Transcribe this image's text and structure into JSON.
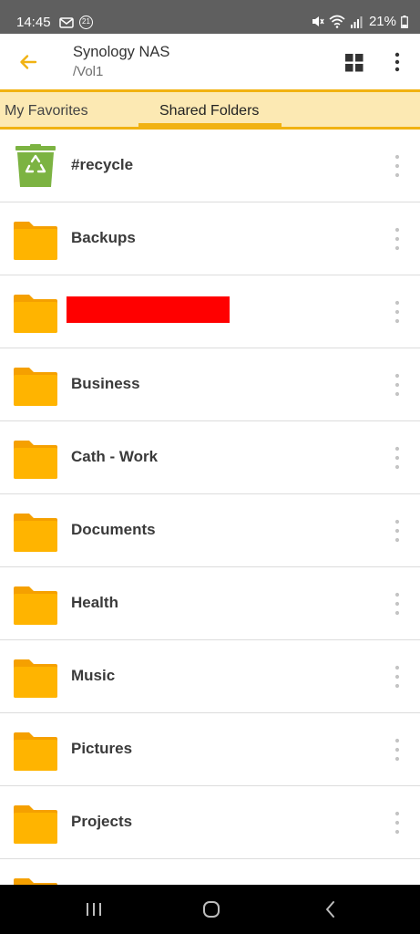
{
  "status_bar": {
    "time": "14:45",
    "notification_badge": "21",
    "battery": "21%"
  },
  "app_bar": {
    "title": "Synology NAS",
    "subtitle": "/Vol1"
  },
  "tabs": [
    {
      "label": "My Favorites",
      "active": false
    },
    {
      "label": "Shared Folders",
      "active": true
    }
  ],
  "items": [
    {
      "name": "#recycle",
      "icon": "recycle-bin-icon"
    },
    {
      "name": "Backups",
      "icon": "folder-icon"
    },
    {
      "name": "",
      "icon": "folder-icon",
      "redacted": true
    },
    {
      "name": "Business",
      "icon": "folder-icon"
    },
    {
      "name": "Cath - Work",
      "icon": "folder-icon"
    },
    {
      "name": "Documents",
      "icon": "folder-icon"
    },
    {
      "name": "Health",
      "icon": "folder-icon"
    },
    {
      "name": "Music",
      "icon": "folder-icon"
    },
    {
      "name": "Pictures",
      "icon": "folder-icon"
    },
    {
      "name": "Projects",
      "icon": "folder-icon"
    },
    {
      "name": "",
      "icon": "folder-icon"
    }
  ],
  "colors": {
    "accent": "#f1b212",
    "folder": "#ffb400",
    "recycle": "#7cb342",
    "tab_bg": "#fce9b3",
    "status_bar": "#5f5f5f"
  }
}
